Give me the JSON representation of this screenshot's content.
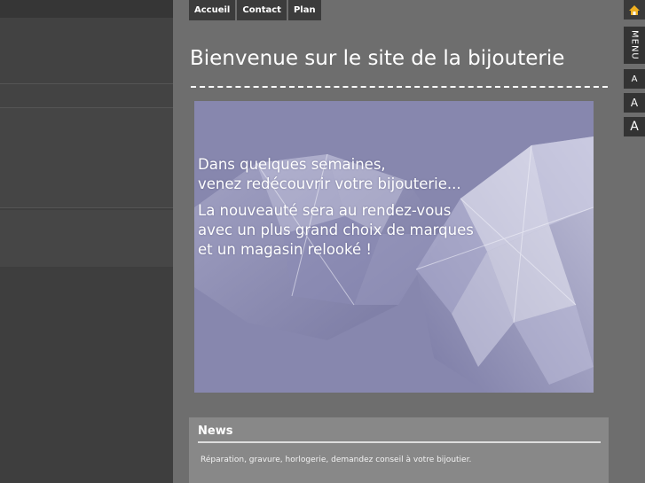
{
  "nav": {
    "items": [
      {
        "label": "Accueil"
      },
      {
        "label": "Contact"
      },
      {
        "label": "Plan"
      }
    ]
  },
  "page": {
    "title": "Bienvenue sur le site de la bijouterie"
  },
  "hero": {
    "line1": "Dans quelques semaines,",
    "line2": "venez redécouvrir votre bijouterie...",
    "line3": "La nouveauté sera au rendez-vous",
    "line4": "avec un plus grand choix de marques",
    "line5": "et un magasin relooké !"
  },
  "news": {
    "title": "News",
    "text": "Réparation, gravure, horlogerie, demandez conseil à votre bijoutier."
  },
  "toolbar": {
    "menu_label": "MENU",
    "font_small": "A",
    "font_medium": "A",
    "font_large": "A",
    "home_icon": "home-icon"
  },
  "colors": {
    "background": "#6e6e6e",
    "sidebar": "#3e3e3e",
    "hero": "#8787ae",
    "news_panel": "#888888"
  }
}
